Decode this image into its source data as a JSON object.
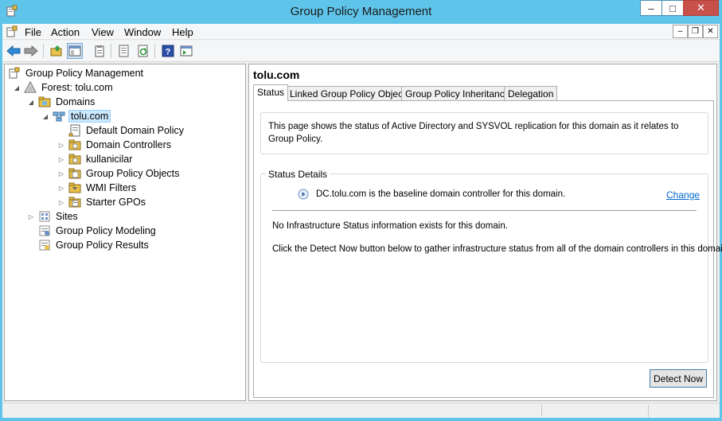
{
  "window": {
    "title": "Group Policy Management",
    "min_icon": "minimize-icon",
    "max_icon": "maximize-icon",
    "close_icon": "close-icon"
  },
  "menu": {
    "items": [
      "File",
      "Action",
      "View",
      "Window",
      "Help"
    ]
  },
  "toolbar": {
    "buttons": [
      "back-arrow-icon",
      "forward-arrow-icon",
      "up-folder-icon",
      "show-hide-tree-icon",
      "properties-icon",
      "export-list-icon",
      "refresh-icon",
      "help-icon",
      "show-action-pane-icon"
    ]
  },
  "tree": {
    "root": "Group Policy Management",
    "forest": "Forest: tolu.com",
    "domains": "Domains",
    "domain": "tolu.com",
    "children": [
      "Default Domain Policy",
      "Domain Controllers",
      "kullanicilar",
      "Group Policy Objects",
      "WMI Filters",
      "Starter GPOs"
    ],
    "sites": "Sites",
    "modeling": "Group Policy Modeling",
    "results": "Group Policy Results"
  },
  "content": {
    "domain_title": "tolu.com",
    "tabs": [
      "Status",
      "Linked Group Policy Objects",
      "Group Policy Inheritance",
      "Delegation"
    ],
    "active_tab": "Status",
    "intro": "This page shows the status of Active Directory and SYSVOL replication for this domain as it relates to Group Policy.",
    "status_details": {
      "legend": "Status Details",
      "baseline": "DC.tolu.com is the baseline domain controller for this domain.",
      "change_link": "Change",
      "no_info": "No Infrastructure Status information exists for this domain.",
      "instruction": "Click the Detect Now button below to gather infrastructure status from all of the domain controllers in this domain."
    },
    "detect_button": "Detect Now"
  },
  "colors": {
    "titlebar": "#5fc4ea",
    "close_button": "#c7504b",
    "selection": "#cce8ff",
    "link": "#0066cc"
  }
}
